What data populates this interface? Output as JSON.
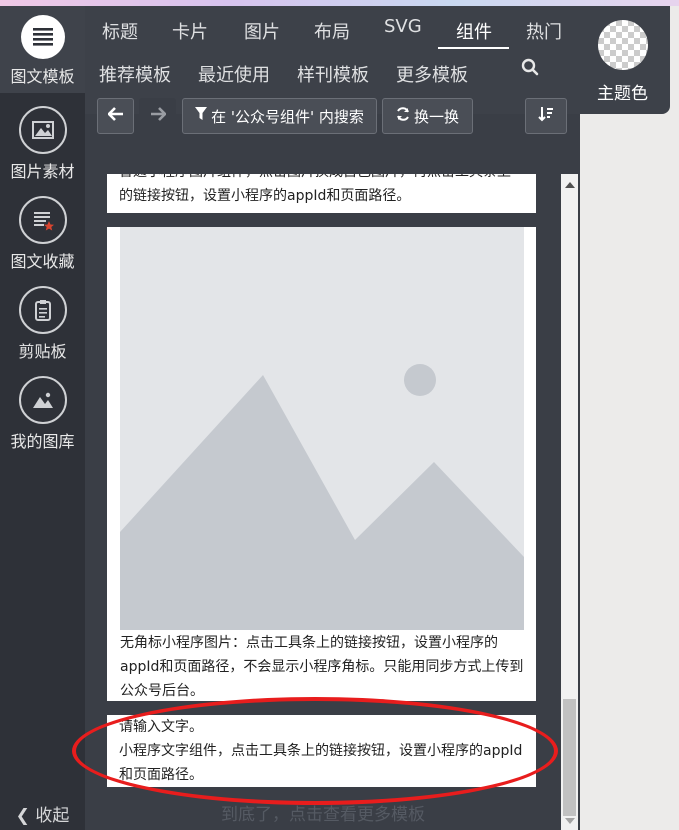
{
  "sidebar": {
    "items": [
      {
        "label": "图文模板",
        "icon": "list-icon"
      },
      {
        "label": "图片素材",
        "icon": "image-icon"
      },
      {
        "label": "图文收藏",
        "icon": "favorites-icon"
      },
      {
        "label": "剪贴板",
        "icon": "clipboard-icon"
      },
      {
        "label": "我的图库",
        "icon": "gallery-icon"
      }
    ],
    "collapse_label": "收起"
  },
  "tabs_row1": [
    "标题",
    "卡片",
    "图片",
    "布局",
    "SVG",
    "组件",
    "热门"
  ],
  "tabs_row2": [
    "推荐模板",
    "最近使用",
    "样刊模板",
    "更多模板"
  ],
  "theme_label": "主题色",
  "toolbar": {
    "search_in_label": "在 '公众号组件' 内搜索",
    "refresh_label": "换一换"
  },
  "cards": [
    {
      "text": "普通小程序图片组件，点击图片换成自己图片，再点击工具条上的链接按钮，设置小程序的appId和页面路径。"
    },
    {
      "text": "无角标小程序图片：点击工具条上的链接按钮，设置小程序的appId和页面路径，不会显示小程序角标。只能用同步方式上传到公众号后台。"
    },
    {
      "title": "请输入文字。",
      "text": "小程序文字组件，点击工具条上的链接按钮，设置小程序的appId和页面路径。"
    }
  ],
  "footer_text": "到底了，点击查看更多模板",
  "colors": {
    "sidebar": "#2e3138",
    "panel": "#3a3e46",
    "highlight": "#e81d1d"
  }
}
